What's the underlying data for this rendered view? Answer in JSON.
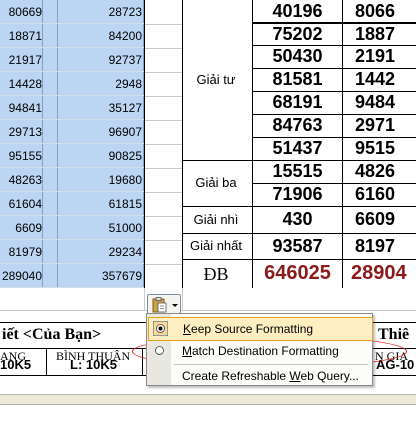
{
  "left_table": {
    "rows": [
      {
        "a": "80669",
        "b": "28723"
      },
      {
        "a": "18871",
        "b": "84200"
      },
      {
        "a": "21917",
        "b": "92737"
      },
      {
        "a": "14428",
        "b": "2948"
      },
      {
        "a": "94841",
        "b": "35127"
      },
      {
        "a": "29713",
        "b": "96907"
      },
      {
        "a": "95155",
        "b": "90825"
      },
      {
        "a": "48263",
        "b": "19680"
      },
      {
        "a": "61604",
        "b": "61815"
      },
      {
        "a": "6609",
        "b": "51000"
      },
      {
        "a": "81979",
        "b": "29234"
      },
      {
        "a": "289040",
        "b": "357679"
      }
    ]
  },
  "right_table": {
    "giai_tu_label": "Giải tư",
    "giai_tu": [
      {
        "v": "40196",
        "w": "8066"
      },
      {
        "v": "75202",
        "w": "1887"
      },
      {
        "v": "50430",
        "w": "2191"
      },
      {
        "v": "81581",
        "w": "1442"
      },
      {
        "v": "68191",
        "w": "9484"
      },
      {
        "v": "84763",
        "w": "2971"
      },
      {
        "v": "51437",
        "w": "9515"
      }
    ],
    "giai_ba_label": "Giải ba",
    "giai_ba": [
      {
        "v": "15515",
        "w": "4826"
      },
      {
        "v": "71906",
        "w": "6160"
      }
    ],
    "giai_nhi_label": "Giải nhì",
    "giai_nhi": {
      "v": "430",
      "w": "6609"
    },
    "giai_nhat_label": "Giải nhất",
    "giai_nhat": {
      "v": "93587",
      "w": "8197"
    },
    "db_label": "ĐB",
    "db": {
      "v": "646025",
      "w": "28904"
    }
  },
  "lower": {
    "title_left": "iết <Của Bạn>",
    "title_right": "Thiê",
    "header_left": "ANG",
    "header_binh_thuan": "BÌNH THUẬN",
    "header_right": "N GIA",
    "val_left": "10K5",
    "val_binh_thuan": "L:  10K5",
    "val_right": "AG-10"
  },
  "paste_menu": {
    "items": [
      {
        "label_pre": "",
        "accel": "K",
        "label_post": "eep Source Formatting"
      },
      {
        "label_pre": "",
        "accel": "M",
        "label_post": "atch Destination Formatting"
      },
      {
        "label_pre": "Create Refreshable ",
        "accel": "W",
        "label_post": "eb Query..."
      }
    ]
  },
  "colors": {
    "selection_blue": "#bcd5f2",
    "db_red": "#8b1a1a",
    "menu_highlight": "#ffeec2",
    "ellipse_red": "#e12222"
  }
}
